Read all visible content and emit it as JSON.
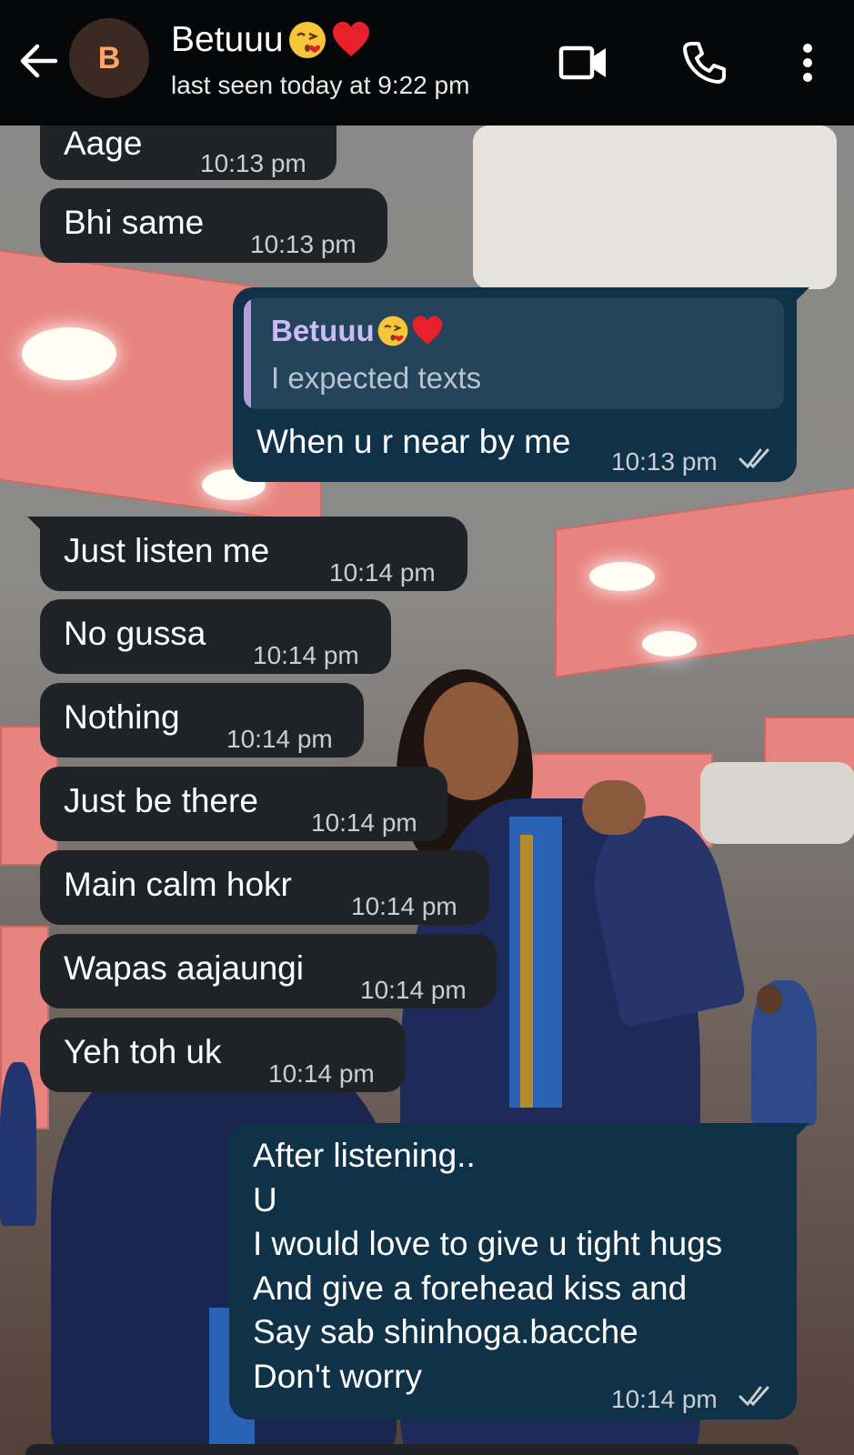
{
  "header": {
    "avatar_letter": "B",
    "contact_name": "Betuuu",
    "contact_emojis": [
      "kiss-face-emoji",
      "red-heart-emoji"
    ],
    "last_seen": "last seen today at 9:22 pm",
    "icons": [
      "back-arrow-icon",
      "video-call-icon",
      "phone-icon",
      "more-vert-icon"
    ]
  },
  "messages": [
    {
      "direction": "incoming",
      "text": "Aage",
      "time": "10:13 pm"
    },
    {
      "direction": "incoming",
      "text": "Bhi same",
      "time": "10:13 pm"
    },
    {
      "direction": "outgoing",
      "quote_author": "Betuuu",
      "quote_text": "I expected texts",
      "text": "When u r near by me",
      "time": "10:13 pm",
      "status": "read"
    },
    {
      "direction": "incoming",
      "text": "Just listen me",
      "time": "10:14 pm"
    },
    {
      "direction": "incoming",
      "text": "No gussa",
      "time": "10:14 pm"
    },
    {
      "direction": "incoming",
      "text": "Nothing",
      "time": "10:14 pm"
    },
    {
      "direction": "incoming",
      "text": "Just be there",
      "time": "10:14 pm"
    },
    {
      "direction": "incoming",
      "text": "Main calm hokr",
      "time": "10:14 pm"
    },
    {
      "direction": "incoming",
      "text": "Wapas aajaungi",
      "time": "10:14 pm"
    },
    {
      "direction": "incoming",
      "text": "Yeh toh uk",
      "time": "10:14 pm"
    },
    {
      "direction": "outgoing",
      "text": "After listening..\nU\nI would love to give u tight hugs\nAnd give a forehead kiss and\nSay sab shinhoga.bacche\nDon't worry",
      "time": "10:14 pm",
      "status": "read"
    }
  ],
  "colors": {
    "header_bg": "#050708",
    "incoming_bubble": "#1f2327",
    "outgoing_bubble": "#103248",
    "quote_bg": "#24445c",
    "quote_bar": "#b39ddb",
    "quote_name": "#cbbcf5",
    "avatar_bg": "#3a2a22",
    "avatar_letter": "#ffa56b"
  }
}
